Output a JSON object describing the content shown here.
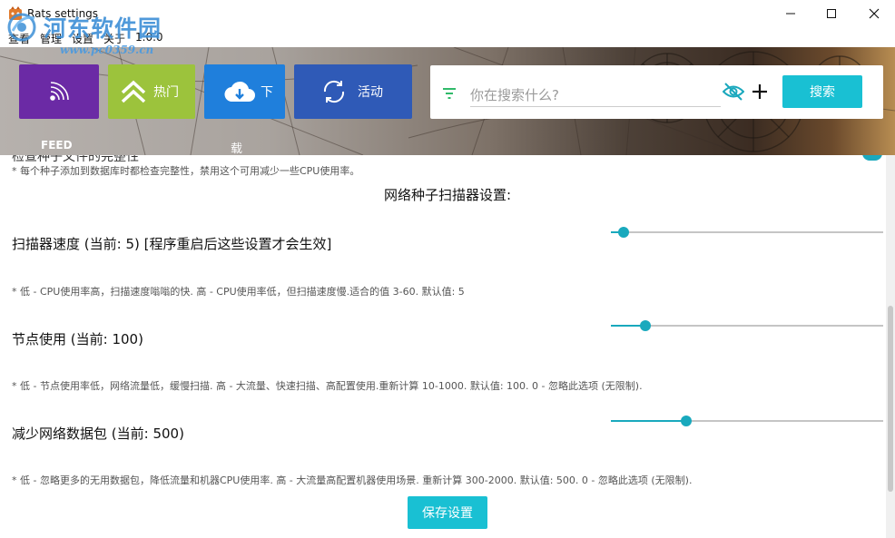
{
  "window": {
    "title": "Rats settings",
    "controls": {
      "minimize": "minimize",
      "maximize": "maximize",
      "close": "close"
    }
  },
  "menu": {
    "items": [
      "查看",
      "管理",
      "设置",
      "关于",
      "1.0.0"
    ]
  },
  "watermark": {
    "title": "河东软件园",
    "url": "www.pc0359.cn"
  },
  "header": {
    "tiles": [
      {
        "id": "feed",
        "label": "",
        "caption": "FEED",
        "icon": "rss-icon",
        "color": "#6b2aa5"
      },
      {
        "id": "hot",
        "label": "热门",
        "icon": "double-chevron-up-icon",
        "color": "#9cc33c"
      },
      {
        "id": "download",
        "label": "下",
        "caption": "载",
        "icon": "cloud-download-icon",
        "color": "#1f7fdc"
      },
      {
        "id": "activity",
        "label": "活动",
        "icon": "refresh-icon",
        "color": "#2f5ab7"
      }
    ],
    "search": {
      "placeholder": "你在搜索什么?",
      "value": "",
      "button_label": "搜索",
      "filter_icon": "filter-icon",
      "visibility_icon": "eye-off-icon",
      "add_icon": "plus-icon"
    }
  },
  "settings": {
    "partial_heading": "检查种子文件的完整性",
    "integrity_note": "* 每个种子添加到数据库时都检查完整性，禁用这个可用减少一些CPU使用率。",
    "section_title": "网络种子扫描器设置:",
    "items": [
      {
        "label": "扫描器速度 (当前: 5) [程序重启后这些设置才会生效]",
        "note": "* 低 - CPU使用率高，扫描速度嗡嗡的快. 高 - CPU使用率低，但扫描速度慢.适合的值 3-60. 默认值: 5",
        "slider_fraction": 0.02
      },
      {
        "label": "节点使用 (当前: 100)",
        "note": "* 低 - 节点使用率低，网络流量低，缓慢扫描. 高 - 大流量、快速扫描、高配置使用.重新计算 10-1000. 默认值: 100. 0 - 忽略此选项 (无限制).",
        "slider_fraction": 0.1
      },
      {
        "label": "减少网络数据包 (当前: 500)",
        "note": "* 低 - 忽略更多的无用数据包，降低流量和机器CPU使用率. 高 - 大流量高配置机器使用场景. 重新计算 300-2000. 默认值: 500. 0 - 忽略此选项 (无限制).",
        "slider_fraction": 0.25
      }
    ],
    "save_label": "保存设置"
  },
  "colors": {
    "accent": "#19c0d3",
    "slider": "#19a9bd"
  }
}
